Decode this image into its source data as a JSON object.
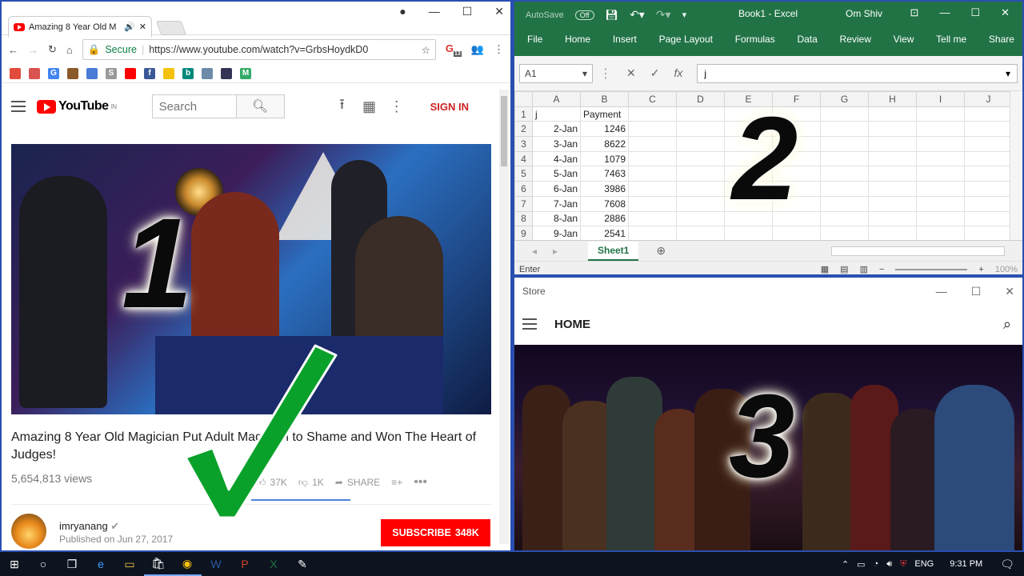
{
  "chrome": {
    "tab_title": "Amazing 8 Year Old M",
    "window_controls": [
      "account-icon",
      "minimize",
      "maximize",
      "close"
    ],
    "secure_label": "Secure",
    "url": "https://www.youtube.com/watch?v=GrbsHoydkD0",
    "ext_badge": "13",
    "bookmarks": [
      {
        "icon": "apps-icon",
        "color": "#e24b3b"
      },
      {
        "icon": "bookmark-icon",
        "color": "#d9534f"
      },
      {
        "icon": "google-icon",
        "color": "#4285f4",
        "glyph": "G"
      },
      {
        "icon": "bookmark-icon",
        "color": "#8b5a2b"
      },
      {
        "icon": "translate-icon",
        "color": "#4a7bd6"
      },
      {
        "icon": "bookmark-icon",
        "color": "#999",
        "glyph": "S"
      },
      {
        "icon": "youtube-icon",
        "color": "#f00"
      },
      {
        "icon": "facebook-icon",
        "color": "#3b5998",
        "glyph": "f"
      },
      {
        "icon": "bookmark-icon",
        "color": "#f4c20d"
      },
      {
        "icon": "bing-icon",
        "color": "#00897b",
        "glyph": "b"
      },
      {
        "icon": "bookmark-icon",
        "color": "#6d8aa8"
      },
      {
        "icon": "bookmark-icon",
        "color": "#335"
      },
      {
        "icon": "bookmark-icon",
        "color": "#3a6",
        "glyph": "M"
      }
    ]
  },
  "youtube": {
    "logo_text": "YouTube",
    "logo_region": "IN",
    "search_placeholder": "Search",
    "sign_in": "SIGN IN",
    "video_title": "Amazing 8 Year Old Magician Put Adult Magician to Shame and Won The Heart of Judges!",
    "views": "5,654,813 views",
    "likes": "37K",
    "dislikes": "1K",
    "share": "SHARE",
    "channel": "imryanang",
    "published": "Published on Jun 27, 2017",
    "subscribe": "SUBSCRIBE",
    "subscribers": "348K"
  },
  "excel": {
    "autosave": "AutoSave",
    "autosave_state": "Off",
    "title": "Book1  -  Excel",
    "user": "Om Shiv",
    "ribbon_tabs": [
      "File",
      "Home",
      "Insert",
      "Page Layout",
      "Formulas",
      "Data",
      "Review",
      "View",
      "Tell me",
      "Share"
    ],
    "name_box": "A1",
    "formula": "j",
    "columns": [
      "A",
      "B",
      "C",
      "D",
      "E",
      "F",
      "G",
      "H",
      "I",
      "J"
    ],
    "rows": [
      {
        "n": "1",
        "a": "j",
        "b": "Payment"
      },
      {
        "n": "2",
        "a": "2-Jan",
        "b": "1246"
      },
      {
        "n": "3",
        "a": "3-Jan",
        "b": "8622"
      },
      {
        "n": "4",
        "a": "4-Jan",
        "b": "1079"
      },
      {
        "n": "5",
        "a": "5-Jan",
        "b": "7463"
      },
      {
        "n": "6",
        "a": "6-Jan",
        "b": "3986"
      },
      {
        "n": "7",
        "a": "7-Jan",
        "b": "7608"
      },
      {
        "n": "8",
        "a": "8-Jan",
        "b": "2886"
      },
      {
        "n": "9",
        "a": "9-Jan",
        "b": "2541"
      }
    ],
    "sheet_tab": "Sheet1",
    "status_mode": "Enter",
    "zoom": "100%"
  },
  "store": {
    "title": "Store",
    "nav_home": "HOME"
  },
  "overlays": {
    "one": "1",
    "two": "2",
    "three": "3"
  },
  "taskbar": {
    "language": "ENG",
    "time": "9:31 PM",
    "apps": [
      "windows-start-icon",
      "cortana-icon",
      "task-view-icon",
      "edge-icon",
      "file-explorer-icon",
      "store-icon",
      "chrome-icon",
      "word-icon",
      "powerpoint-icon",
      "excel-icon",
      "paint-icon"
    ]
  }
}
